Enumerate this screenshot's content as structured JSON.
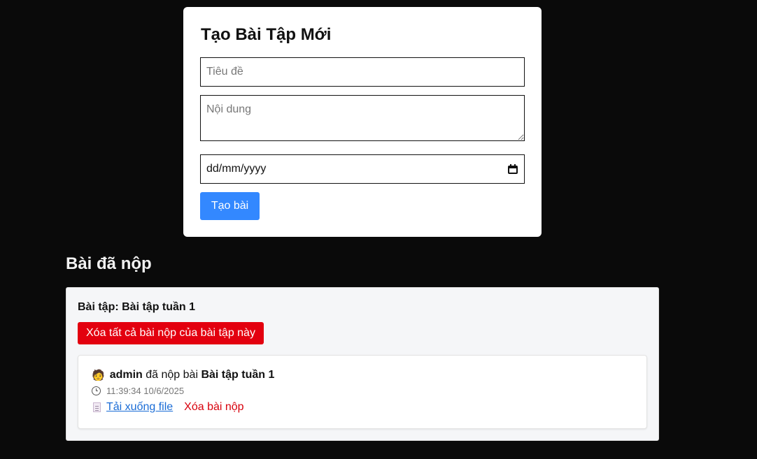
{
  "form": {
    "title": "Tạo Bài Tập Mới",
    "title_placeholder": "Tiêu đề",
    "content_placeholder": "Nội dung",
    "date_value": "dd/mm/yyyy",
    "submit_label": "Tạo bài"
  },
  "submissions": {
    "heading": "Bài đã nộp",
    "groups": [
      {
        "assignment_label": "Bài tập: Bài tập tuần 1",
        "delete_all_label": "Xóa tất cả bài nộp của bài tập này",
        "items": [
          {
            "user_icon": "person-emoji-icon",
            "username": "admin",
            "action_text": "đã nộp bài",
            "assignment_name": "Bài tập tuần 1",
            "timestamp": "11:39:34 10/6/2025",
            "download_label": "Tải xuống file",
            "delete_label": "Xóa bài nộp"
          }
        ]
      }
    ]
  },
  "colors": {
    "page_background": "#0a0a0a",
    "primary_button": "#3388ff",
    "danger_button": "#e3000f",
    "link": "#1a6cd6",
    "danger_link": "#d8000c"
  }
}
